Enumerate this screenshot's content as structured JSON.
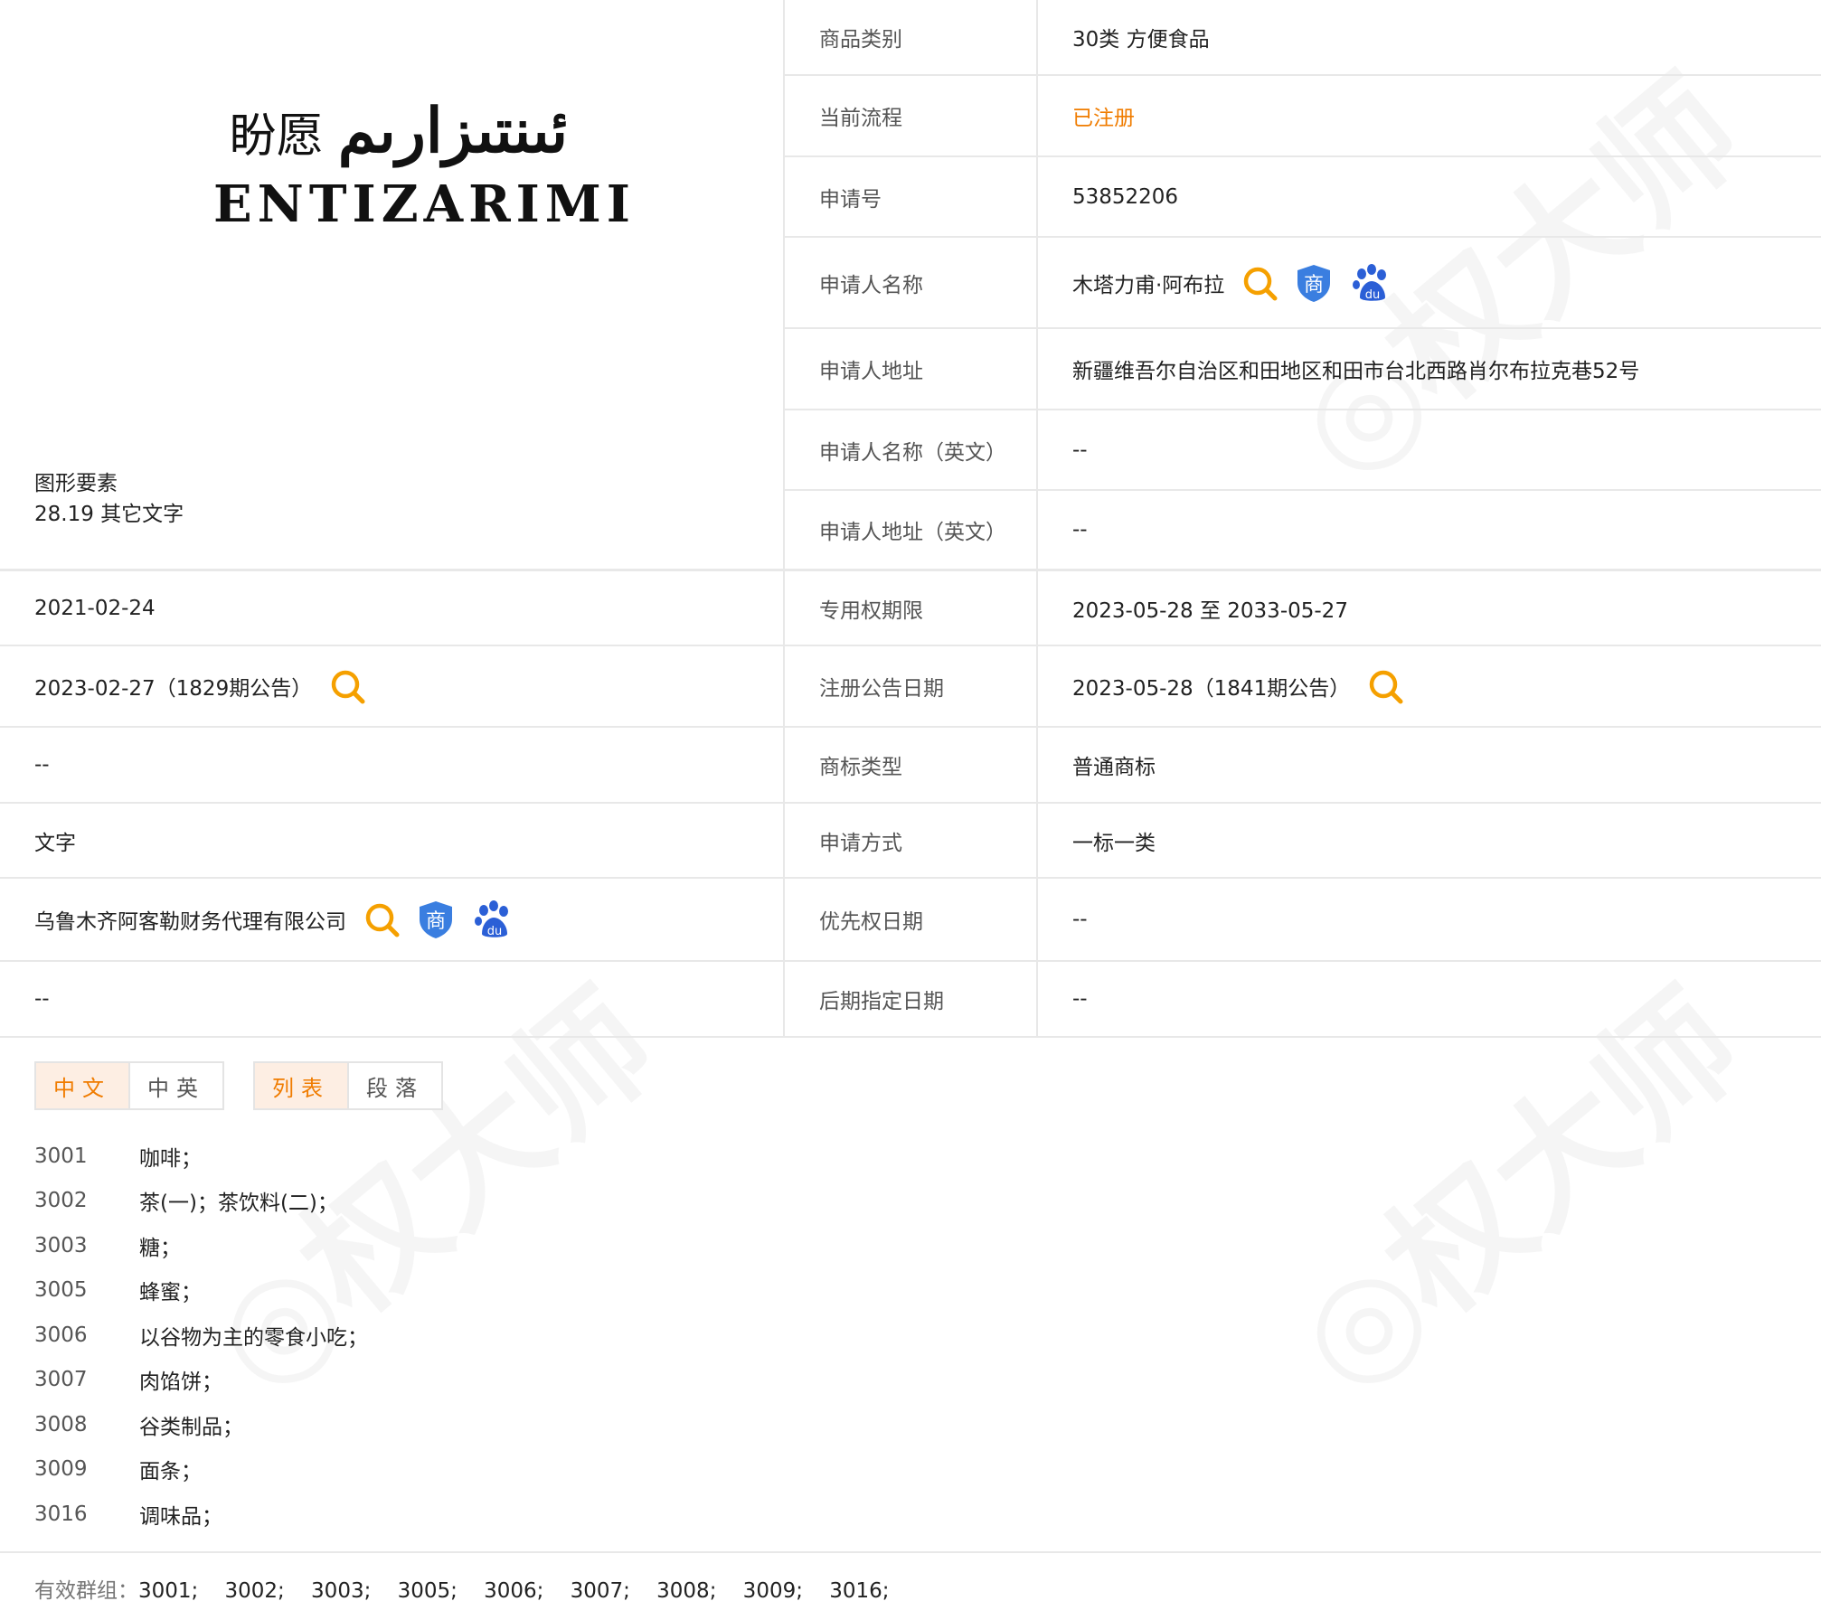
{
  "logo": {
    "cn_text": "盼愿",
    "ar_text": "ئىنتىزارىم",
    "en_text": "ENTIZARIMI"
  },
  "figure": {
    "title": "图形要素",
    "value": "28.19 其它文字"
  },
  "details": [
    {
      "label": "商品类别",
      "value": "30类 方便食品"
    },
    {
      "label": "当前流程",
      "value": "已注册"
    },
    {
      "label": "申请号",
      "value": "53852206"
    },
    {
      "label": "申请人名称",
      "value": "木塔力甫·阿布拉"
    },
    {
      "label": "申请人地址",
      "value": "新疆维吾尔自治区和田地区和田市台北西路肖尔布拉克巷52号"
    },
    {
      "label": "申请人名称（英文）",
      "value": "--"
    },
    {
      "label": "申请人地址（英文）",
      "value": "--"
    }
  ],
  "rows": [
    {
      "left": "2021-02-24",
      "label": "专用权期限",
      "value": "2023-05-28 至 2033-05-27"
    },
    {
      "left": "2023-02-27（1829期公告）",
      "label": "注册公告日期",
      "value": "2023-05-28（1841期公告）"
    },
    {
      "left": "--",
      "label": "商标类型",
      "value": "普通商标"
    },
    {
      "left": "文字",
      "label": "申请方式",
      "value": "一标一类"
    },
    {
      "left": "乌鲁木齐阿客勒财务代理有限公司",
      "label": "优先权日期",
      "value": "--"
    },
    {
      "left": "--",
      "label": "后期指定日期",
      "value": "--"
    }
  ],
  "tabs": {
    "lang": [
      "中文",
      "中英"
    ],
    "view": [
      "列表",
      "段落"
    ]
  },
  "goods": [
    {
      "code": "3001",
      "name": "咖啡；"
    },
    {
      "code": "3002",
      "name": "茶(一)；茶饮料(二)；"
    },
    {
      "code": "3003",
      "name": "糖；"
    },
    {
      "code": "3005",
      "name": "蜂蜜；"
    },
    {
      "code": "3006",
      "name": "以谷物为主的零食小吃；"
    },
    {
      "code": "3007",
      "name": "肉馅饼；"
    },
    {
      "code": "3008",
      "name": "谷类制品；"
    },
    {
      "code": "3009",
      "name": "面条；"
    },
    {
      "code": "3016",
      "name": "调味品；"
    }
  ],
  "footer": {
    "label": "有效群组：",
    "value": "3001;    3002;    3003;    3005;    3006;    3007;    3008;    3009;    3016;"
  },
  "colors": {
    "accent": "#f07c00",
    "shield": "#3a7ee0",
    "paw": "#2b5fd6"
  }
}
